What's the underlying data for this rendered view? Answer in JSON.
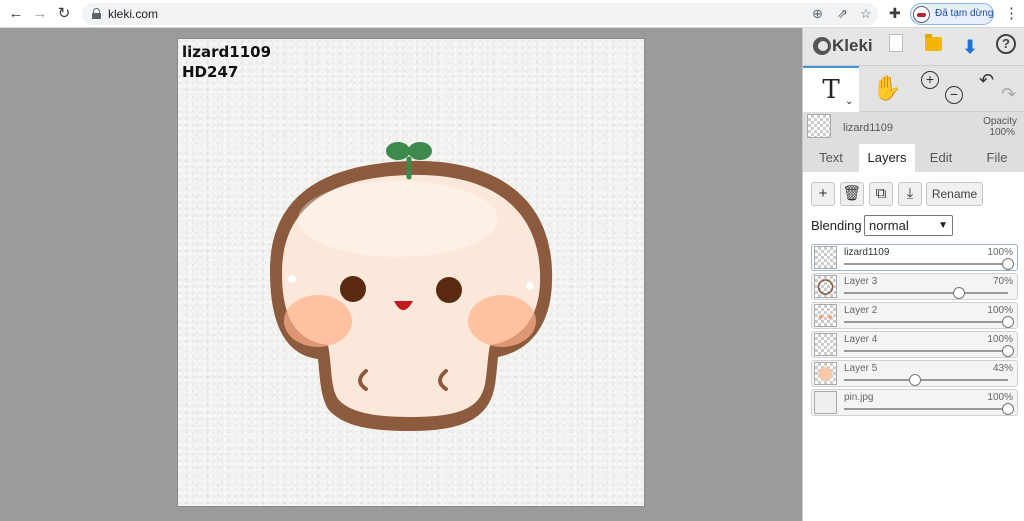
{
  "browser": {
    "url": "kleki.com",
    "profile_label": "Đã tạm dừng",
    "back_icon": "arrow-left-icon",
    "forward_icon": "arrow-right-icon",
    "reload_icon": "reload-icon"
  },
  "canvas": {
    "line1": "lizard1109",
    "line2": "HD247"
  },
  "app": {
    "logo_text": "Kleki",
    "help_label": "?"
  },
  "tools": {
    "text_label": "T",
    "zoom_in": "+",
    "zoom_out": "−"
  },
  "current_layer": {
    "name": "lizard1109",
    "opacity_label": "Opacity",
    "opacity_value": "100%"
  },
  "tabs": [
    {
      "label": "Text"
    },
    {
      "label": "Layers"
    },
    {
      "label": "Edit"
    },
    {
      "label": "File"
    }
  ],
  "layer_buttons": {
    "add": "+",
    "rename": "Rename"
  },
  "blending": {
    "label": "Blending",
    "value": "normal"
  },
  "layers": [
    {
      "name": "lizard1109",
      "opacity": "100%",
      "level": 1.0
    },
    {
      "name": "Layer 3",
      "opacity": "70%",
      "level": 0.7
    },
    {
      "name": "Layer 2",
      "opacity": "100%",
      "level": 1.0
    },
    {
      "name": "Layer 4",
      "opacity": "100%",
      "level": 1.0
    },
    {
      "name": "Layer 5",
      "opacity": "43%",
      "level": 0.43
    },
    {
      "name": "pin.jpg",
      "opacity": "100%",
      "level": 1.0
    }
  ],
  "colors": {
    "accent": "#1e73d8",
    "outline_brown": "#8a5a3b",
    "sprout_green": "#3d8a4c"
  }
}
